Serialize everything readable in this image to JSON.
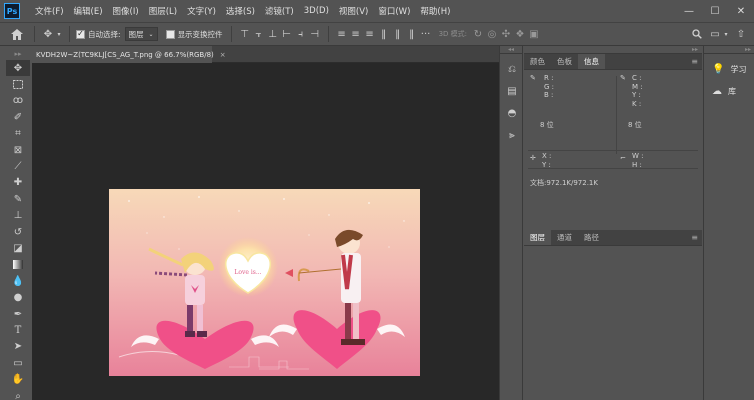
{
  "app": {
    "logo_text": "Ps",
    "menu": [
      "文件(F)",
      "编辑(E)",
      "图像(I)",
      "图层(L)",
      "文字(Y)",
      "选择(S)",
      "滤镜(T)",
      "3D(D)",
      "视图(V)",
      "窗口(W)",
      "帮助(H)"
    ],
    "window_controls": {
      "minimize": "—",
      "maximize": "☐",
      "close": "✕"
    }
  },
  "options_bar": {
    "auto_select_label": "自动选择:",
    "auto_select_target": "图层",
    "show_transform_label": "显示变换控件",
    "mode_3d_label": "3D 模式:"
  },
  "document": {
    "tab_title": "KVDH2W~Z(TC9KLJ[CS_AG_T.png @ 66.7%(RGB/8)",
    "close_glyph": "×",
    "artwork_text": "Love is..."
  },
  "tools": [
    "move-tool",
    "marquee-tool",
    "lasso-tool",
    "quick-select-tool",
    "crop-tool",
    "frame-tool",
    "eyedropper-tool",
    "healing-brush-tool",
    "brush-tool",
    "clone-stamp-tool",
    "history-brush-tool",
    "eraser-tool",
    "gradient-tool",
    "blur-tool",
    "dodge-tool",
    "pen-tool",
    "type-tool",
    "path-select-tool",
    "shape-tool",
    "hand-tool",
    "zoom-tool"
  ],
  "info_panel": {
    "tabs": [
      "颜色",
      "色板",
      "信息"
    ],
    "active_tab": "信息",
    "left_channels": [
      "R :",
      "G :",
      "B :"
    ],
    "right_channels": [
      "C :",
      "M :",
      "Y :",
      "K :"
    ],
    "left_bit": "8 位",
    "right_bit": "8 位",
    "xy": [
      "X :",
      "Y :"
    ],
    "wh": [
      "W :",
      "H :"
    ],
    "doc_size": "文档:972.1K/972.1K"
  },
  "layers_panel": {
    "tabs": [
      "图层",
      "通道",
      "路径"
    ],
    "active_tab": "图层"
  },
  "far_right_panel": {
    "items": [
      {
        "icon": "lightbulb-icon",
        "label": "学习"
      },
      {
        "icon": "cloud-library-icon",
        "label": "库"
      }
    ]
  },
  "colors": {
    "app_bg": "#535353",
    "canvas_bg": "#282828",
    "accent": "#31a8ff"
  }
}
